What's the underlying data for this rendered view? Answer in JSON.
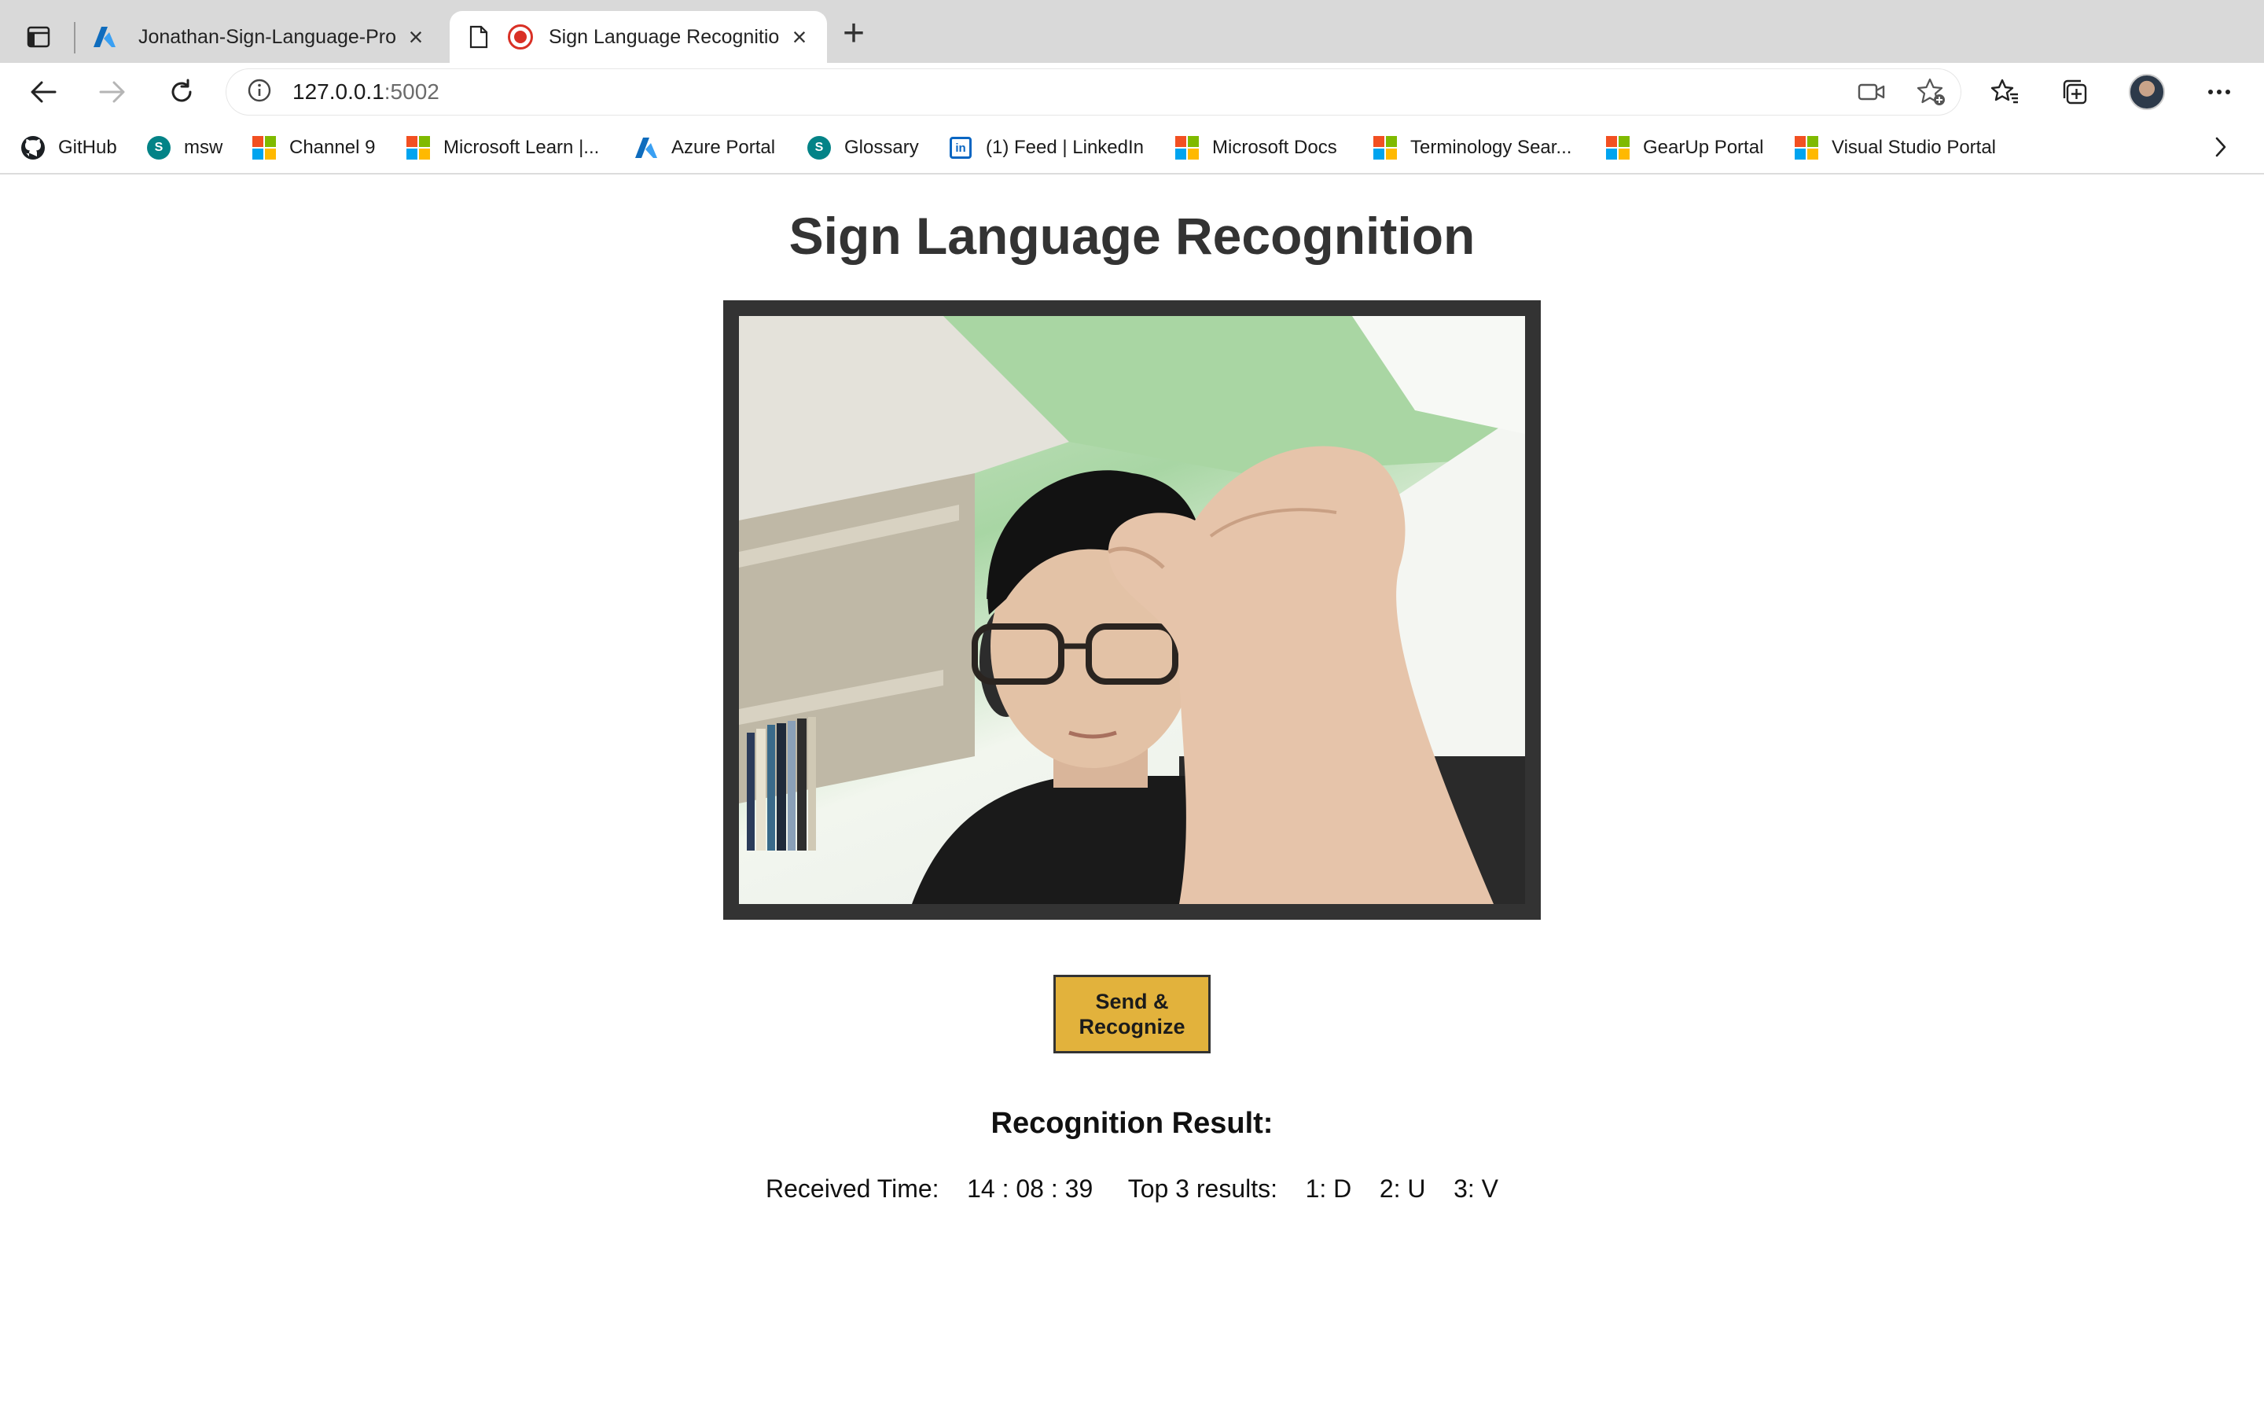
{
  "browser": {
    "tabs": [
      {
        "title": "Jonathan-Sign-Language-Pro",
        "favicon": "azure-icon",
        "active": false
      },
      {
        "title": "Sign Language Recognitio",
        "favicon": "page-icon",
        "recording": true,
        "active": true
      }
    ],
    "address": {
      "host": "127.0.0.1",
      "port": ":5002"
    },
    "bookmarks": [
      {
        "label": "GitHub",
        "icon": "github-icon"
      },
      {
        "label": "msw",
        "icon": "sharepoint-icon"
      },
      {
        "label": "Channel 9",
        "icon": "microsoft-icon"
      },
      {
        "label": "Microsoft Learn |...",
        "icon": "microsoft-icon"
      },
      {
        "label": "Azure Portal",
        "icon": "azure-icon"
      },
      {
        "label": "Glossary",
        "icon": "sharepoint-icon"
      },
      {
        "label": "(1) Feed | LinkedIn",
        "icon": "linkedin-icon"
      },
      {
        "label": "Microsoft Docs",
        "icon": "microsoft-icon"
      },
      {
        "label": "Terminology Sear...",
        "icon": "microsoft-icon"
      },
      {
        "label": "GearUp Portal",
        "icon": "microsoft-icon"
      },
      {
        "label": "Visual Studio Portal",
        "icon": "microsoft-icon"
      }
    ]
  },
  "page": {
    "title": "Sign Language Recognition",
    "send_button": "Send & Recognize",
    "result_heading": "Recognition Result:",
    "received_label": "Received Time:",
    "received_time": "14 : 08 : 39",
    "top3_label": "Top 3 results:",
    "results": [
      "1: D",
      "2: U",
      "3: V"
    ]
  },
  "colors": {
    "accent_button": "#e2b23c",
    "frame": "#333333",
    "title_text": "#333333",
    "recording": "#d93025"
  }
}
